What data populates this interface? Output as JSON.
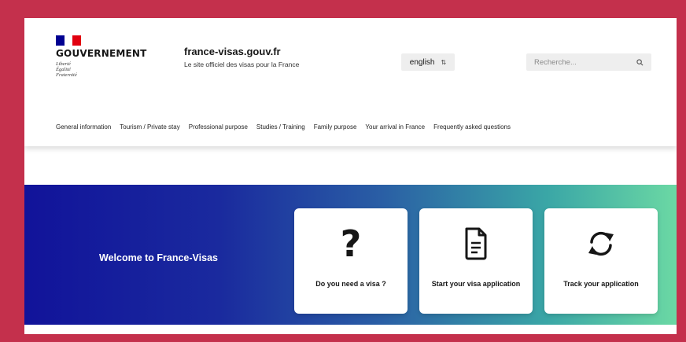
{
  "header": {
    "gov_title": "GOUVERNEMENT",
    "motto": [
      "Liberté",
      "Égalité",
      "Fraternité"
    ],
    "site_name": "france-visas.gouv.fr",
    "site_tagline": "Le site officiel des visas pour la France",
    "language": "english",
    "search_placeholder": "Recherche..."
  },
  "nav": {
    "items": [
      "General information",
      "Tourism / Private stay",
      "Professional purpose",
      "Studies / Training",
      "Family purpose",
      "Your arrival in France",
      "Frequently asked questions"
    ]
  },
  "hero": {
    "welcome": "Welcome to France-Visas",
    "cards": [
      {
        "label": "Do you need a visa ?",
        "icon": "question-mark-icon"
      },
      {
        "label": "Start your visa application",
        "icon": "document-icon"
      },
      {
        "label": "Track your application",
        "icon": "refresh-icon"
      }
    ]
  },
  "colors": {
    "frame_border": "#c4304c",
    "flag_blue": "#000091",
    "flag_red": "#e1000f",
    "hero_start": "#11139a",
    "hero_end": "#6bd8a4"
  }
}
